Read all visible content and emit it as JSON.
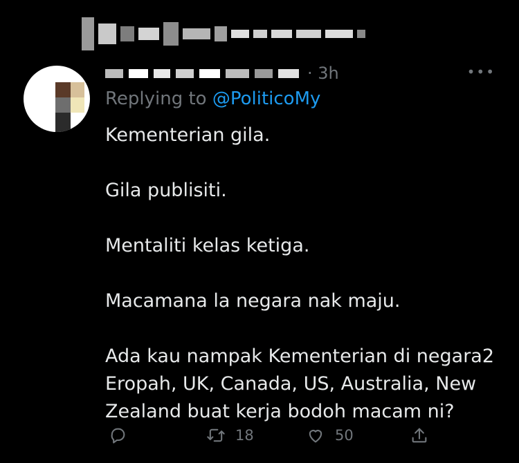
{
  "tweet": {
    "time": "3h",
    "replying_prefix": "Replying to ",
    "replying_mention": "@PoliticoMy",
    "paragraphs": [
      "Kementerian gila.",
      "Gila publisiti.",
      "Mentaliti kelas ketiga.",
      "Macamana la negara nak maju.",
      "Ada kau nampak Kementerian di negara2 Eropah, UK, Canada, US, Australia, New Zealand buat kerja bodoh macam ni?"
    ],
    "actions": {
      "reply_count": "",
      "retweet_count": "18",
      "like_count": "50"
    }
  },
  "colors": {
    "background": "#000000",
    "text": "#e7e9ea",
    "muted": "#71767b",
    "link": "#1d9bf0"
  },
  "icons": [
    "reply-icon",
    "retweet-icon",
    "like-icon",
    "share-icon",
    "more-options-icon"
  ]
}
